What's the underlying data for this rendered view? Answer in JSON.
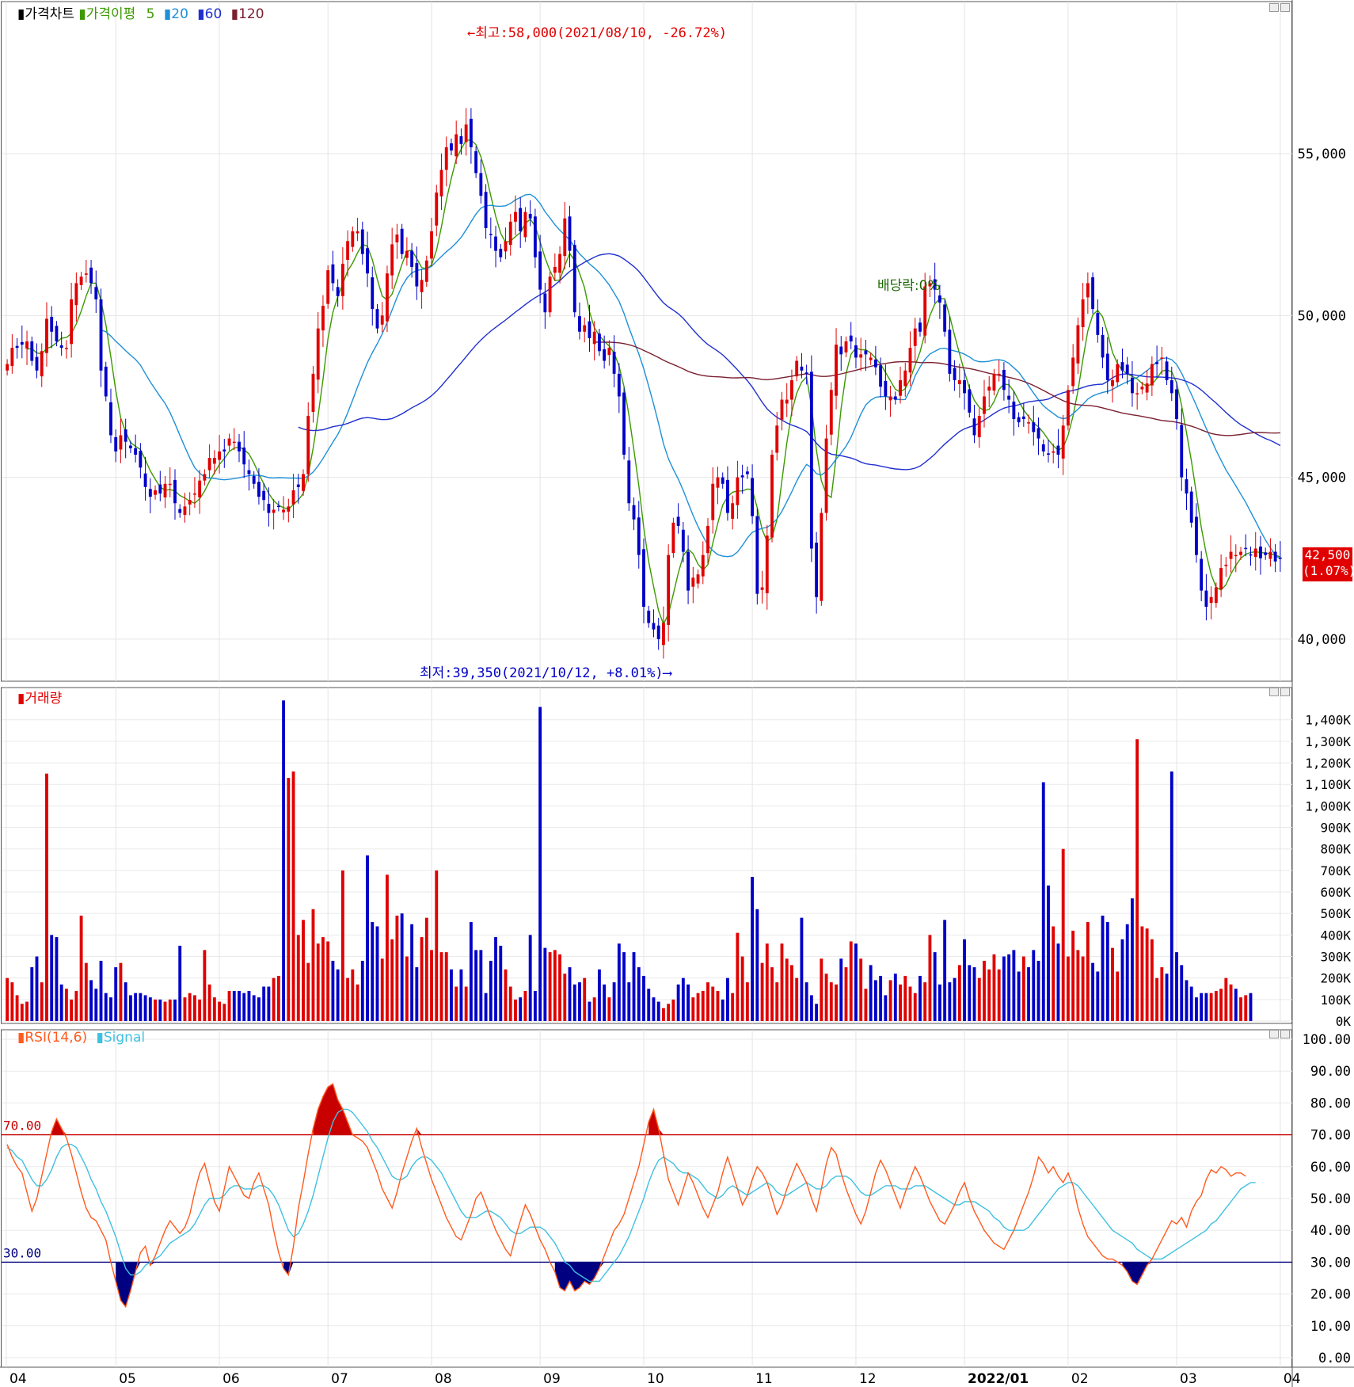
{
  "legends": {
    "price": {
      "title": "가격차트",
      "ma_title": "가격이평",
      "ma": [
        "5",
        "20",
        "60",
        "120"
      ]
    },
    "volume": {
      "title": "거래량"
    },
    "rsi": {
      "title": "RSI(14,6)",
      "signal": "Signal"
    }
  },
  "annotations": {
    "high": "←최고:58,000(2021/08/10, -26.72%)",
    "low": "최저:39,350(2021/10/12, +8.01%)⟶",
    "dividend": "배당락:0%"
  },
  "current_price": {
    "value": "42,500",
    "change": "(1.07%)"
  },
  "colors": {
    "up": "#e00000",
    "down": "#0000c8",
    "ma5": "#3c9a00",
    "ma20": "#1e90d8",
    "ma60": "#2030d0",
    "ma120": "#7a2030",
    "rsi": "#ff5a1e",
    "signal": "#40c0e0",
    "overbought": "#c80000",
    "oversold": "#000080"
  },
  "chart_data": [
    {
      "type": "candlestick",
      "title": "가격차트",
      "y_ticks": [
        "55,000",
        "50,000",
        "45,000",
        "40,000"
      ],
      "ylim": [
        38700,
        59700
      ],
      "x_ticks": [
        "04",
        "05",
        "06",
        "07",
        "08",
        "09",
        "10",
        "11",
        "12",
        "2022/01",
        "02",
        "03",
        "04"
      ],
      "series_close": [
        48500,
        49000,
        49000,
        49100,
        49200,
        48600,
        48300,
        48900,
        49900,
        49500,
        49200,
        49000,
        49000,
        50500,
        51000,
        51200,
        51300,
        51000,
        50500,
        48300,
        47500,
        46300,
        45800,
        46300,
        46100,
        45900,
        45700,
        45300,
        44700,
        44400,
        44600,
        44500,
        44800,
        44800,
        44200,
        43900,
        44100,
        44300,
        44500,
        44900,
        45100,
        45600,
        45600,
        45800,
        45800,
        46200,
        46100,
        45800,
        45400,
        45100,
        44800,
        44400,
        44300,
        43900,
        44000,
        44100,
        44000,
        44100,
        44600,
        44700,
        45100,
        46900,
        48200,
        49600,
        50300,
        51400,
        51000,
        50600,
        51600,
        52300,
        52600,
        52600,
        51900,
        51300,
        50200,
        49600,
        50000,
        51300,
        52200,
        52500,
        51900,
        52000,
        51500,
        50900,
        51100,
        51700,
        52600,
        53800,
        54500,
        55200,
        55100,
        55600,
        55300,
        55900,
        55200,
        54400,
        53700,
        52700,
        52500,
        52000,
        51800,
        52300,
        52900,
        53200,
        52600,
        53200,
        53000,
        51800,
        50800,
        50100,
        51200,
        51500,
        51900,
        53000,
        52000,
        50100,
        49500,
        49700,
        49300,
        49500,
        48900,
        48600,
        49000,
        48200,
        47500,
        45700,
        44200,
        43700,
        42600,
        41000,
        40500,
        40300,
        40000,
        40500,
        42600,
        43600,
        43500,
        42700,
        41500,
        41900,
        42000,
        42600,
        43500,
        44800,
        45000,
        44800,
        43900,
        44200,
        45000,
        45000,
        45100,
        43800,
        41400,
        41600,
        43200,
        45700,
        46600,
        47400,
        47400,
        48000,
        48600,
        48300,
        48200,
        42800,
        41300,
        43900,
        46200,
        47700,
        49100,
        48800,
        49200,
        49200,
        48700,
        48800,
        48800,
        48700,
        48400,
        47800,
        47500,
        47500,
        47400,
        48000,
        48300,
        49000,
        49600,
        49500,
        50900,
        51000,
        50800,
        50400,
        49500,
        48200,
        48000,
        48000,
        47600,
        47000,
        46300,
        46900,
        47500,
        47800,
        48200,
        48200,
        47700,
        47400,
        46800,
        46700,
        46800,
        46700,
        46400,
        46200,
        45800,
        45700,
        45800,
        45700,
        46600,
        47700,
        48700,
        49700,
        50500,
        51000,
        50200,
        49400,
        48700,
        48000,
        48000,
        48500,
        48300,
        48200,
        47600,
        47600,
        47800,
        47900,
        48500,
        48500,
        48700,
        48000,
        47600,
        46800,
        45000,
        44500,
        43600,
        42600,
        41500,
        41000,
        41300,
        41600,
        42200,
        42300,
        42700,
        42600,
        42700,
        42800,
        42600,
        42800,
        42500,
        42600,
        42700,
        42400,
        42500
      ]
    },
    {
      "type": "bar",
      "title": "거래량",
      "y_ticks": [
        "1,400K",
        "1,300K",
        "1,200K",
        "1,100K",
        "1,000K",
        "900K",
        "800K",
        "700K",
        "600K",
        "500K",
        "400K",
        "300K",
        "200K",
        "100K",
        "0K"
      ],
      "ylim": [
        0,
        1550000
      ],
      "values_k": [
        200,
        180,
        120,
        80,
        90,
        250,
        300,
        180,
        1150,
        400,
        390,
        170,
        150,
        100,
        140,
        490,
        270,
        190,
        150,
        280,
        130,
        110,
        250,
        270,
        180,
        120,
        130,
        130,
        120,
        110,
        100,
        100,
        90,
        100,
        100,
        350,
        110,
        130,
        120,
        100,
        330,
        170,
        110,
        90,
        80,
        140,
        140,
        140,
        130,
        140,
        120,
        110,
        160,
        160,
        200,
        210,
        1490,
        1130,
        1160,
        400,
        470,
        270,
        520,
        360,
        390,
        370,
        280,
        240,
        700,
        200,
        240,
        170,
        280,
        770,
        460,
        440,
        290,
        680,
        380,
        490,
        500,
        300,
        450,
        250,
        390,
        480,
        330,
        700,
        320,
        320,
        240,
        160,
        240,
        160,
        460,
        330,
        330,
        130,
        280,
        390,
        350,
        240,
        160,
        100,
        110,
        140,
        400,
        140,
        1460,
        340,
        320,
        330,
        310,
        220,
        250,
        170,
        180,
        200,
        90,
        110,
        240,
        170,
        110,
        180,
        360,
        320,
        180,
        320,
        250,
        210,
        150,
        110,
        90,
        60,
        80,
        100,
        170,
        200,
        170,
        110,
        130,
        140,
        180,
        160,
        140,
        100,
        200,
        130,
        410,
        300,
        180,
        670,
        520,
        270,
        360,
        250,
        180,
        360,
        290,
        260,
        200,
        480,
        180,
        120,
        80,
        290,
        220,
        180,
        170,
        290,
        250,
        370,
        360,
        290,
        150,
        260,
        190,
        210,
        120,
        190,
        220,
        170,
        210,
        160,
        130,
        210,
        180,
        400,
        320,
        170,
        470,
        180,
        200,
        260,
        380,
        260,
        250,
        200,
        280,
        240,
        310,
        240,
        300,
        310,
        330,
        230,
        300,
        250,
        330,
        280,
        1110,
        630,
        440,
        360,
        800,
        300,
        420,
        330,
        300,
        460,
        270,
        230,
        490,
        460,
        340,
        230,
        380,
        450,
        570,
        1310,
        440,
        430,
        380,
        200,
        250,
        220,
        1160,
        320,
        260,
        190,
        160,
        110,
        130,
        130,
        130,
        140,
        150,
        200,
        170,
        150,
        110,
        120,
        130
      ]
    },
    {
      "type": "line",
      "title": "RSI(14,6)",
      "y_ticks": [
        "100.00",
        "90.00",
        "80.00",
        "70.00",
        "60.00",
        "50.00",
        "40.00",
        "30.00",
        "20.00",
        "10.00",
        "0.00"
      ],
      "ylim": [
        0,
        100
      ],
      "levels": {
        "overbought": "70.00",
        "oversold": "30.00"
      },
      "series": [
        {
          "name": "RSI(14,6)",
          "values": [
            67,
            63,
            60,
            58,
            52,
            46,
            50,
            57,
            64,
            71,
            75,
            72,
            69,
            64,
            58,
            52,
            47,
            44,
            43,
            40,
            37,
            30,
            24,
            18,
            16,
            21,
            27,
            33,
            35,
            29,
            32,
            36,
            40,
            43,
            41,
            39,
            41,
            45,
            52,
            58,
            61,
            55,
            49,
            46,
            53,
            60,
            57,
            54,
            51,
            50,
            55,
            58,
            53,
            48,
            40,
            33,
            28,
            26,
            35,
            47,
            55,
            64,
            72,
            78,
            82,
            85,
            86,
            81,
            78,
            74,
            70,
            69,
            68,
            66,
            62,
            58,
            53,
            50,
            47,
            52,
            58,
            63,
            68,
            72,
            66,
            61,
            56,
            52,
            48,
            44,
            41,
            38,
            37,
            41,
            45,
            50,
            52,
            48,
            44,
            40,
            37,
            34,
            32,
            38,
            43,
            48,
            45,
            41,
            37,
            34,
            30,
            27,
            22,
            21,
            24,
            21,
            22,
            24,
            23,
            25,
            28,
            32,
            36,
            40,
            42,
            45,
            50,
            55,
            60,
            67,
            74,
            78,
            72,
            64,
            56,
            52,
            48,
            53,
            58,
            55,
            51,
            47,
            44,
            48,
            52,
            58,
            63,
            58,
            53,
            48,
            51,
            56,
            60,
            58,
            55,
            50,
            45,
            48,
            53,
            57,
            61,
            58,
            55,
            50,
            46,
            53,
            61,
            66,
            64,
            58,
            53,
            49,
            45,
            42,
            46,
            52,
            58,
            62,
            59,
            55,
            51,
            47,
            52,
            56,
            60,
            57,
            53,
            49,
            46,
            43,
            42,
            45,
            48,
            52,
            55,
            50,
            46,
            43,
            40,
            38,
            36,
            35,
            34,
            37,
            40,
            44,
            48,
            52,
            57,
            63,
            61,
            58,
            60,
            57,
            55,
            58,
            54,
            47,
            42,
            38,
            36,
            34,
            32,
            31,
            31,
            30,
            29,
            27,
            24,
            23,
            26,
            29,
            31,
            34,
            37,
            40,
            43,
            42,
            44,
            41,
            46,
            49,
            51,
            56,
            59,
            58,
            60,
            59,
            57,
            58,
            58,
            57
          ]
        },
        {
          "name": "Signal",
          "values": [
            66,
            65,
            63,
            62,
            59,
            56,
            54,
            54,
            56,
            59,
            63,
            66,
            67,
            67,
            66,
            63,
            60,
            56,
            53,
            49,
            46,
            42,
            38,
            33,
            28,
            26,
            26,
            27,
            29,
            30,
            31,
            32,
            34,
            36,
            37,
            38,
            39,
            40,
            42,
            45,
            48,
            50,
            50,
            50,
            51,
            53,
            54,
            54,
            53,
            53,
            53,
            54,
            54,
            53,
            51,
            48,
            44,
            40,
            38,
            39,
            42,
            46,
            51,
            57,
            63,
            69,
            74,
            77,
            78,
            78,
            77,
            75,
            73,
            71,
            68,
            66,
            63,
            60,
            57,
            56,
            56,
            57,
            60,
            62,
            63,
            63,
            62,
            60,
            58,
            55,
            52,
            49,
            46,
            44,
            44,
            44,
            45,
            46,
            46,
            45,
            44,
            42,
            40,
            39,
            39,
            40,
            41,
            41,
            41,
            40,
            38,
            36,
            33,
            30,
            29,
            27,
            26,
            25,
            24,
            24,
            24,
            26,
            28,
            30,
            32,
            35,
            38,
            42,
            46,
            50,
            55,
            59,
            62,
            63,
            62,
            61,
            59,
            58,
            58,
            57,
            56,
            54,
            52,
            51,
            50,
            51,
            53,
            54,
            53,
            52,
            51,
            52,
            53,
            54,
            55,
            54,
            52,
            51,
            51,
            52,
            53,
            54,
            55,
            54,
            53,
            53,
            54,
            56,
            57,
            57,
            57,
            56,
            54,
            52,
            51,
            51,
            52,
            53,
            54,
            54,
            54,
            53,
            53,
            53,
            54,
            54,
            54,
            53,
            52,
            51,
            50,
            49,
            48,
            48,
            49,
            49,
            49,
            48,
            47,
            46,
            44,
            43,
            41,
            40,
            40,
            40,
            40,
            41,
            43,
            45,
            47,
            49,
            51,
            53,
            54,
            55,
            55,
            54,
            52,
            50,
            48,
            46,
            44,
            42,
            40,
            39,
            38,
            37,
            36,
            34,
            33,
            32,
            31,
            31,
            31,
            32,
            33,
            34,
            35,
            36,
            37,
            38,
            39,
            40,
            42,
            43,
            45,
            47,
            49,
            51,
            53,
            54,
            55,
            55
          ]
        }
      ]
    }
  ]
}
